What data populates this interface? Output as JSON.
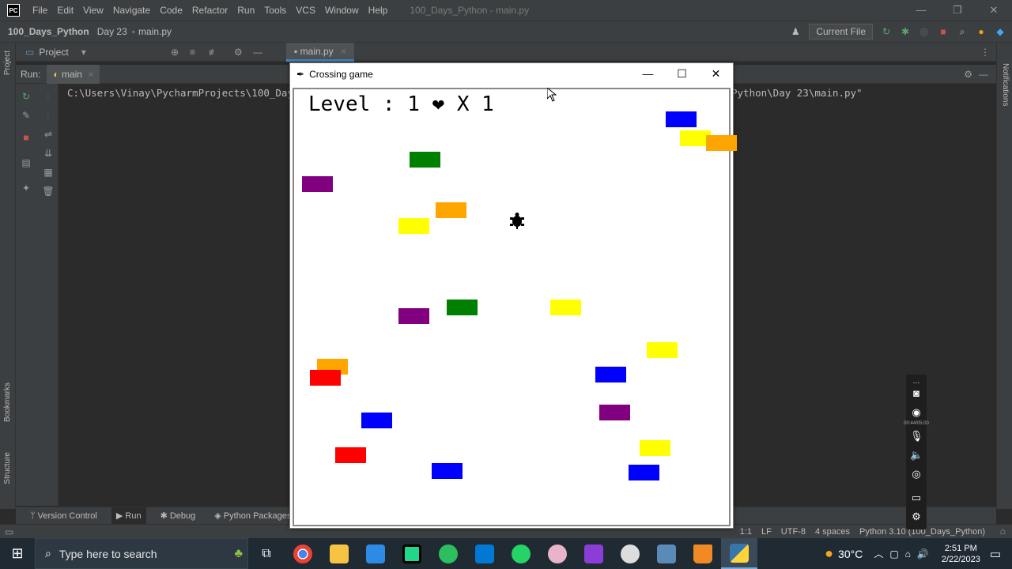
{
  "app": {
    "title": "100_Days_Python - main.py",
    "logo": "PC",
    "menu": [
      "File",
      "Edit",
      "View",
      "Navigate",
      "Code",
      "Refactor",
      "Run",
      "Tools",
      "VCS",
      "Window",
      "Help"
    ]
  },
  "breadcrumb": [
    "100_Days_Python",
    "Day 23",
    "main.py"
  ],
  "nav_right": {
    "run_config": "Current File"
  },
  "left_stripe": {
    "project": "Project",
    "bookmarks": "Bookmarks",
    "structure": "Structure"
  },
  "right_stripe": {
    "notifications": "Notifications"
  },
  "project_panel": {
    "label": "Project"
  },
  "editor": {
    "tab": "main.py"
  },
  "run_panel": {
    "label": "Run:",
    "tab": "main"
  },
  "console": {
    "line_start": "C:\\Users\\Vinay\\PycharmProjects\\100_Day",
    "line_end": "Python\\Day 23\\main.py\""
  },
  "bottom_tabs": [
    "Version Control",
    "Run",
    "Debug",
    "Python Packages"
  ],
  "status": {
    "position": "1:1",
    "line_sep": "LF",
    "encoding": "UTF-8",
    "indent": "4 spaces",
    "interpreter": "Python 3.10 (100_Days_Python)"
  },
  "game": {
    "window_title": "Crossing game",
    "score_text": "Level : 1 ❤ X 1",
    "colors": {
      "blue": "#0000ff",
      "yellow": "#ffff00",
      "orange": "#ffa500",
      "green": "#008000",
      "purple": "#800080",
      "red": "#ff0000"
    },
    "cars": [
      {
        "color": "blue"
      },
      {
        "color": "yellow"
      },
      {
        "color": "orange"
      },
      {
        "color": "green"
      },
      {
        "color": "purple"
      },
      {
        "color": "orange"
      },
      {
        "color": "yellow"
      },
      {
        "color": "purple"
      },
      {
        "color": "green"
      },
      {
        "color": "yellow"
      },
      {
        "color": "yellow"
      },
      {
        "color": "orange"
      },
      {
        "color": "red"
      },
      {
        "color": "blue"
      },
      {
        "color": "blue"
      },
      {
        "color": "purple"
      },
      {
        "color": "red"
      },
      {
        "color": "yellow"
      },
      {
        "color": "blue"
      },
      {
        "color": "blue"
      }
    ]
  },
  "recorder": {
    "timer": "00:44/05:00"
  },
  "taskbar": {
    "search_placeholder": "Type here to search",
    "weather": "30°C",
    "time": "2:51 PM",
    "date": "2/22/2023"
  }
}
